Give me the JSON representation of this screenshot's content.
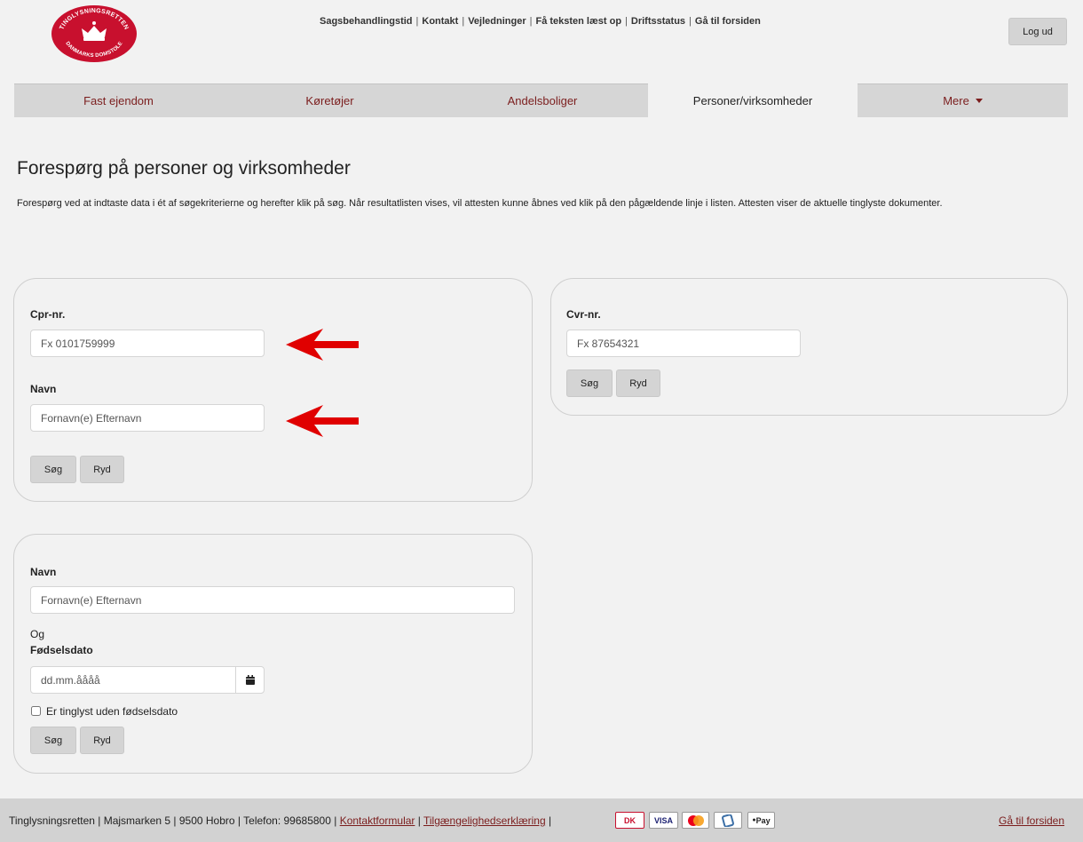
{
  "logo": {
    "text_top": "TINGLYSNINGSRETTEN",
    "text_bottom": "DANMARKS DOMSTOLE"
  },
  "header": {
    "links": [
      "Sagsbehandlingstid",
      "Kontakt",
      "Vejledninger",
      "Få teksten læst op",
      "Driftsstatus",
      "Gå til forsiden"
    ],
    "separator": "|",
    "logout_label": "Log ud"
  },
  "tabs": [
    {
      "label": "Fast ejendom"
    },
    {
      "label": "Køretøjer"
    },
    {
      "label": "Andelsboliger"
    },
    {
      "label": "Personer/virksomheder"
    },
    {
      "label": "Mere"
    }
  ],
  "page": {
    "title": "Forespørg på personer og virksomheder",
    "intro": "Forespørg ved at indtaste data i ét af søgekriterierne og herefter klik på søg. Når resultatlisten vises, vil attesten kunne åbnes ved klik på den pågældende linje i listen. Attesten viser de aktuelle tinglyste dokumenter."
  },
  "panel_cpr": {
    "cpr_label": "Cpr-nr.",
    "cpr_placeholder": "Fx 0101759999",
    "name_label": "Navn",
    "name_placeholder": "Fornavn(e) Efternavn",
    "search_label": "Søg",
    "clear_label": "Ryd"
  },
  "panel_cvr": {
    "cvr_label": "Cvr-nr.",
    "cvr_placeholder": "Fx 87654321",
    "search_label": "Søg",
    "clear_label": "Ryd"
  },
  "panel_name_dob": {
    "name_label": "Navn",
    "name_placeholder": "Fornavn(e) Efternavn",
    "and_text": "Og",
    "dob_label": "Fødselsdato",
    "dob_placeholder": "dd.mm.åååå",
    "checkbox_label": "Er tinglyst uden fødselsdato",
    "search_label": "Søg",
    "clear_label": "Ryd"
  },
  "footer": {
    "address": "Tinglysningsretten | Majsmarken 5 | 9500 Hobro | Telefon: 99685800 |",
    "contact_link": "Kontaktformular",
    "accessibility_link": "Tilgængelighedserklæring",
    "pay_dankort": "DK",
    "pay_visa": "VISA",
    "pay_applepay": "Pay",
    "home_link": "Gå til forsiden"
  },
  "colors": {
    "brand_red": "#c8102e",
    "link_red": "#7b1d1d",
    "arrow_red": "#e00000"
  }
}
